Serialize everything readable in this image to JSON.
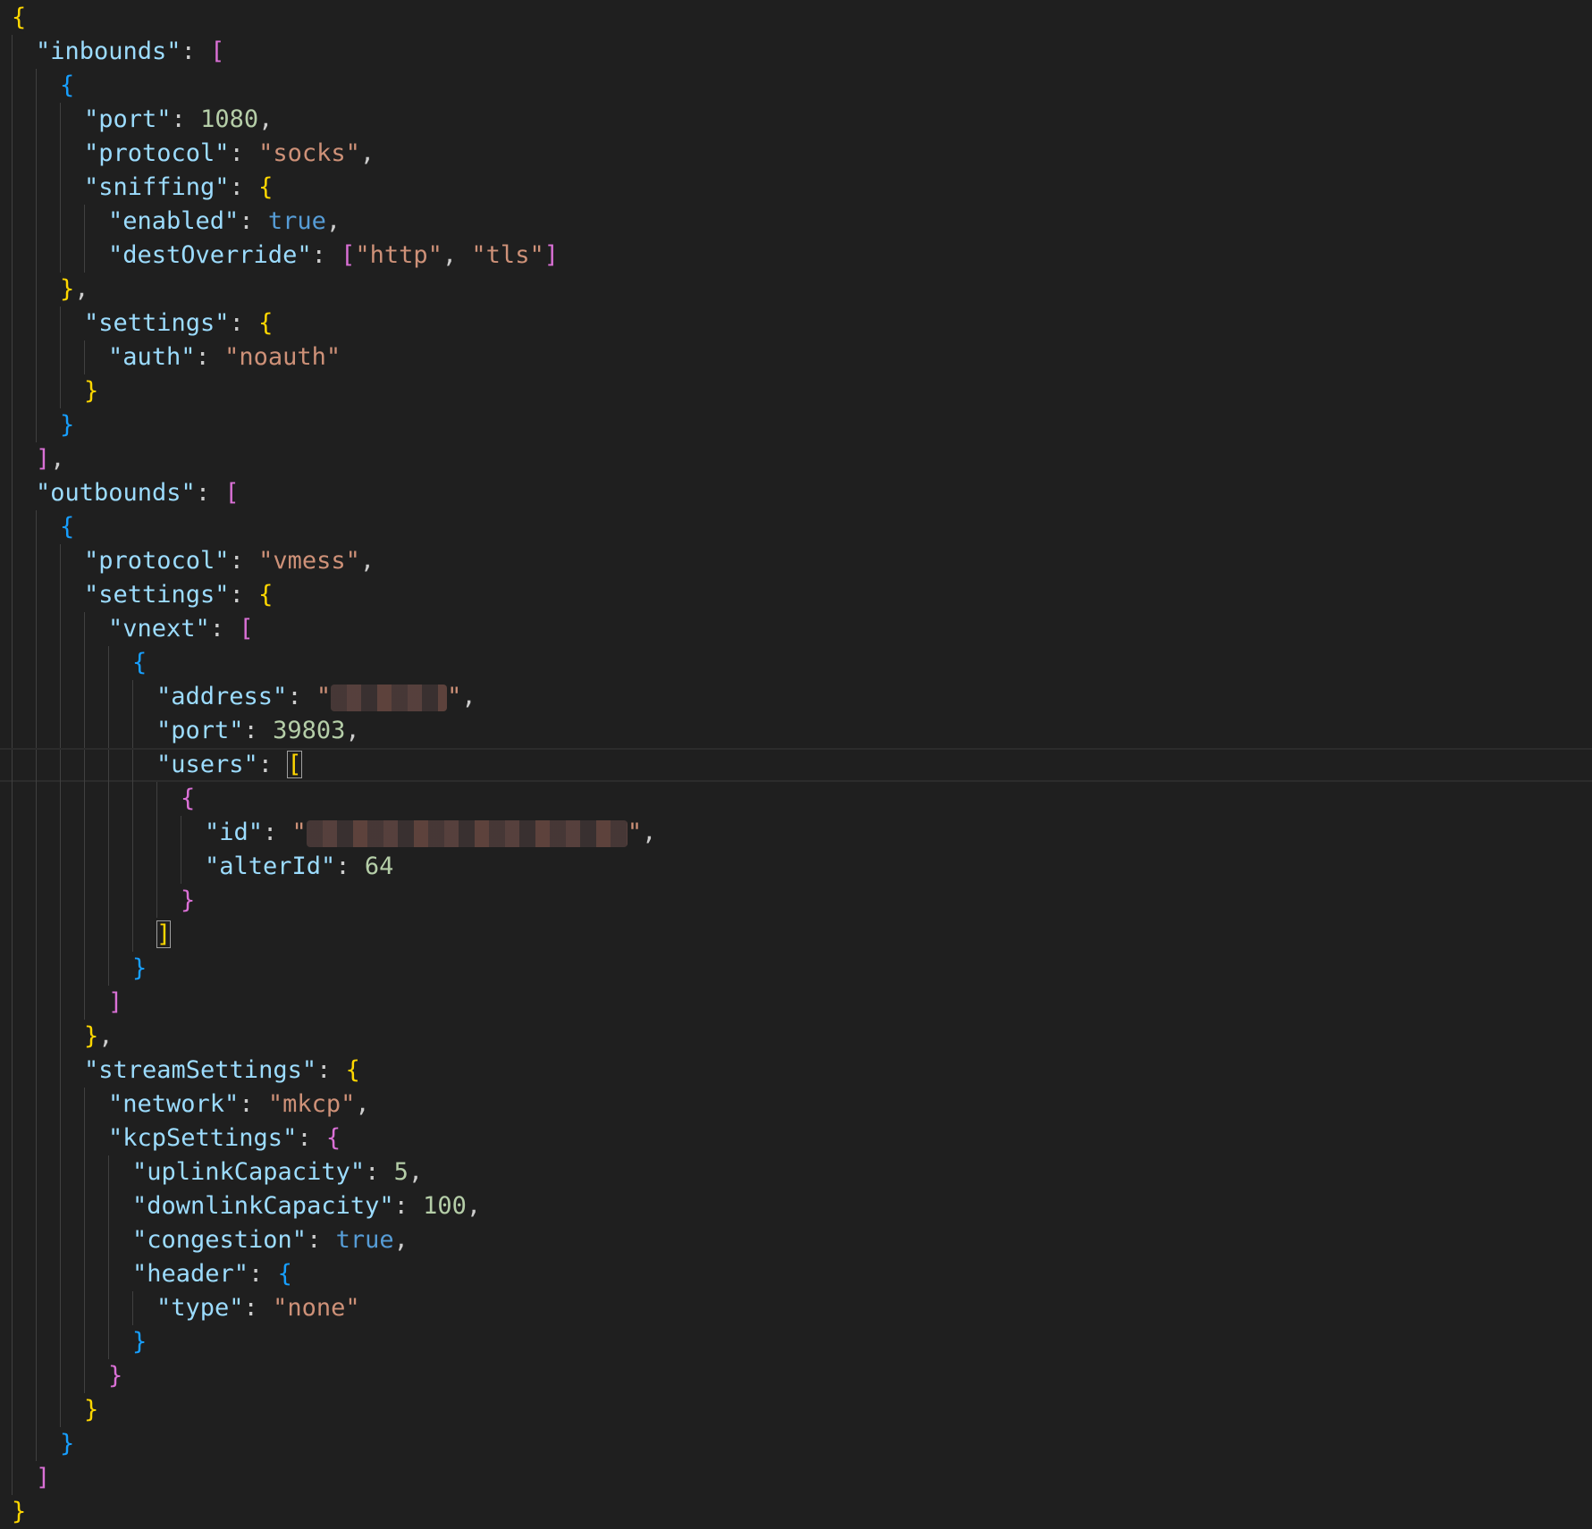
{
  "editor": {
    "lines": [
      {
        "indent": 0,
        "current": false,
        "tokens": [
          {
            "t": "{",
            "c": "y"
          }
        ]
      },
      {
        "indent": 1,
        "current": false,
        "tokens": [
          {
            "t": "\"inbounds\"",
            "c": "k"
          },
          {
            "t": ": ",
            "c": "p"
          },
          {
            "t": "[",
            "c": "m"
          }
        ]
      },
      {
        "indent": 2,
        "current": false,
        "tokens": [
          {
            "t": "{",
            "c": "c"
          }
        ]
      },
      {
        "indent": 3,
        "current": false,
        "tokens": [
          {
            "t": "\"port\"",
            "c": "k"
          },
          {
            "t": ": ",
            "c": "p"
          },
          {
            "t": "1080",
            "c": "n"
          },
          {
            "t": ",",
            "c": "p"
          }
        ]
      },
      {
        "indent": 3,
        "current": false,
        "tokens": [
          {
            "t": "\"protocol\"",
            "c": "k"
          },
          {
            "t": ": ",
            "c": "p"
          },
          {
            "t": "\"socks\"",
            "c": "s"
          },
          {
            "t": ",",
            "c": "p"
          }
        ]
      },
      {
        "indent": 3,
        "current": false,
        "tokens": [
          {
            "t": "\"sniffing\"",
            "c": "k"
          },
          {
            "t": ": ",
            "c": "p"
          },
          {
            "t": "{",
            "c": "y"
          }
        ]
      },
      {
        "indent": 4,
        "current": false,
        "tokens": [
          {
            "t": "\"enabled\"",
            "c": "k"
          },
          {
            "t": ": ",
            "c": "p"
          },
          {
            "t": "true",
            "c": "b"
          },
          {
            "t": ",",
            "c": "p"
          }
        ]
      },
      {
        "indent": 4,
        "current": false,
        "tokens": [
          {
            "t": "\"destOverride\"",
            "c": "k"
          },
          {
            "t": ": ",
            "c": "p"
          },
          {
            "t": "[",
            "c": "m"
          },
          {
            "t": "\"http\"",
            "c": "s"
          },
          {
            "t": ", ",
            "c": "p"
          },
          {
            "t": "\"tls\"",
            "c": "s"
          },
          {
            "t": "]",
            "c": "m"
          }
        ]
      },
      {
        "indent": 2,
        "current": false,
        "tokens": [
          {
            "t": "}",
            "c": "y"
          },
          {
            "t": ",",
            "c": "p"
          }
        ]
      },
      {
        "indent": 3,
        "current": false,
        "tokens": [
          {
            "t": "\"settings\"",
            "c": "k"
          },
          {
            "t": ": ",
            "c": "p"
          },
          {
            "t": "{",
            "c": "y"
          }
        ]
      },
      {
        "indent": 4,
        "current": false,
        "tokens": [
          {
            "t": "\"auth\"",
            "c": "k"
          },
          {
            "t": ": ",
            "c": "p"
          },
          {
            "t": "\"noauth\"",
            "c": "s"
          }
        ]
      },
      {
        "indent": 3,
        "current": false,
        "tokens": [
          {
            "t": "}",
            "c": "y"
          }
        ]
      },
      {
        "indent": 2,
        "current": false,
        "tokens": [
          {
            "t": "}",
            "c": "c"
          }
        ]
      },
      {
        "indent": 1,
        "current": false,
        "tokens": [
          {
            "t": "]",
            "c": "m"
          },
          {
            "t": ",",
            "c": "p"
          }
        ]
      },
      {
        "indent": 1,
        "current": false,
        "tokens": [
          {
            "t": "\"outbounds\"",
            "c": "k"
          },
          {
            "t": ": ",
            "c": "p"
          },
          {
            "t": "[",
            "c": "m"
          }
        ]
      },
      {
        "indent": 2,
        "current": false,
        "tokens": [
          {
            "t": "{",
            "c": "c"
          }
        ]
      },
      {
        "indent": 3,
        "current": false,
        "tokens": [
          {
            "t": "\"protocol\"",
            "c": "k"
          },
          {
            "t": ": ",
            "c": "p"
          },
          {
            "t": "\"vmess\"",
            "c": "s"
          },
          {
            "t": ",",
            "c": "p"
          }
        ]
      },
      {
        "indent": 3,
        "current": false,
        "tokens": [
          {
            "t": "\"settings\"",
            "c": "k"
          },
          {
            "t": ": ",
            "c": "p"
          },
          {
            "t": "{",
            "c": "y"
          }
        ]
      },
      {
        "indent": 4,
        "current": false,
        "tokens": [
          {
            "t": "\"vnext\"",
            "c": "k"
          },
          {
            "t": ": ",
            "c": "p"
          },
          {
            "t": "[",
            "c": "m"
          }
        ]
      },
      {
        "indent": 5,
        "current": false,
        "tokens": [
          {
            "t": "{",
            "c": "c"
          }
        ]
      },
      {
        "indent": 6,
        "current": false,
        "tokens": [
          {
            "t": "\"address\"",
            "c": "k"
          },
          {
            "t": ": ",
            "c": "p"
          },
          {
            "t": "\"",
            "c": "s"
          },
          {
            "redact": 8
          },
          {
            "t": "\"",
            "c": "s"
          },
          {
            "t": ",",
            "c": "p"
          }
        ]
      },
      {
        "indent": 6,
        "current": false,
        "tokens": [
          {
            "t": "\"port\"",
            "c": "k"
          },
          {
            "t": ": ",
            "c": "p"
          },
          {
            "t": "39803",
            "c": "n"
          },
          {
            "t": ",",
            "c": "p"
          }
        ]
      },
      {
        "indent": 6,
        "current": true,
        "tokens": [
          {
            "t": "\"users\"",
            "c": "k"
          },
          {
            "t": ": ",
            "c": "p"
          },
          {
            "t": "[",
            "c": "y",
            "match": true
          }
        ]
      },
      {
        "indent": 7,
        "current": false,
        "tokens": [
          {
            "t": "{",
            "c": "m"
          }
        ]
      },
      {
        "indent": 8,
        "current": false,
        "tokens": [
          {
            "t": "\"id\"",
            "c": "k"
          },
          {
            "t": ": ",
            "c": "p"
          },
          {
            "t": "\"",
            "c": "s"
          },
          {
            "redact": 22
          },
          {
            "t": "\"",
            "c": "s"
          },
          {
            "t": ",",
            "c": "p"
          }
        ]
      },
      {
        "indent": 8,
        "current": false,
        "tokens": [
          {
            "t": "\"alterId\"",
            "c": "k"
          },
          {
            "t": ": ",
            "c": "p"
          },
          {
            "t": "64",
            "c": "n"
          }
        ]
      },
      {
        "indent": 7,
        "current": false,
        "tokens": [
          {
            "t": "}",
            "c": "m"
          }
        ]
      },
      {
        "indent": 6,
        "current": false,
        "tokens": [
          {
            "t": "]",
            "c": "y",
            "match": true
          }
        ]
      },
      {
        "indent": 5,
        "current": false,
        "tokens": [
          {
            "t": "}",
            "c": "c"
          }
        ]
      },
      {
        "indent": 4,
        "current": false,
        "tokens": [
          {
            "t": "]",
            "c": "m"
          }
        ]
      },
      {
        "indent": 3,
        "current": false,
        "tokens": [
          {
            "t": "}",
            "c": "y"
          },
          {
            "t": ",",
            "c": "p"
          }
        ]
      },
      {
        "indent": 3,
        "current": false,
        "tokens": [
          {
            "t": "\"streamSettings\"",
            "c": "k"
          },
          {
            "t": ": ",
            "c": "p"
          },
          {
            "t": "{",
            "c": "y"
          }
        ]
      },
      {
        "indent": 4,
        "current": false,
        "tokens": [
          {
            "t": "\"network\"",
            "c": "k"
          },
          {
            "t": ": ",
            "c": "p"
          },
          {
            "t": "\"mkcp\"",
            "c": "s"
          },
          {
            "t": ",",
            "c": "p"
          }
        ]
      },
      {
        "indent": 4,
        "current": false,
        "tokens": [
          {
            "t": "\"kcpSettings\"",
            "c": "k"
          },
          {
            "t": ": ",
            "c": "p"
          },
          {
            "t": "{",
            "c": "m"
          }
        ]
      },
      {
        "indent": 5,
        "current": false,
        "tokens": [
          {
            "t": "\"uplinkCapacity\"",
            "c": "k"
          },
          {
            "t": ": ",
            "c": "p"
          },
          {
            "t": "5",
            "c": "n"
          },
          {
            "t": ",",
            "c": "p"
          }
        ]
      },
      {
        "indent": 5,
        "current": false,
        "tokens": [
          {
            "t": "\"downlinkCapacity\"",
            "c": "k"
          },
          {
            "t": ": ",
            "c": "p"
          },
          {
            "t": "100",
            "c": "n"
          },
          {
            "t": ",",
            "c": "p"
          }
        ]
      },
      {
        "indent": 5,
        "current": false,
        "tokens": [
          {
            "t": "\"congestion\"",
            "c": "k"
          },
          {
            "t": ": ",
            "c": "p"
          },
          {
            "t": "true",
            "c": "b"
          },
          {
            "t": ",",
            "c": "p"
          }
        ]
      },
      {
        "indent": 5,
        "current": false,
        "tokens": [
          {
            "t": "\"header\"",
            "c": "k"
          },
          {
            "t": ": ",
            "c": "p"
          },
          {
            "t": "{",
            "c": "c"
          }
        ]
      },
      {
        "indent": 6,
        "current": false,
        "tokens": [
          {
            "t": "\"type\"",
            "c": "k"
          },
          {
            "t": ": ",
            "c": "p"
          },
          {
            "t": "\"none\"",
            "c": "s"
          }
        ]
      },
      {
        "indent": 5,
        "current": false,
        "tokens": [
          {
            "t": "}",
            "c": "c"
          }
        ]
      },
      {
        "indent": 4,
        "current": false,
        "tokens": [
          {
            "t": "}",
            "c": "m"
          }
        ]
      },
      {
        "indent": 3,
        "current": false,
        "tokens": [
          {
            "t": "}",
            "c": "y"
          }
        ]
      },
      {
        "indent": 2,
        "current": false,
        "tokens": [
          {
            "t": "}",
            "c": "c"
          }
        ]
      },
      {
        "indent": 1,
        "current": false,
        "tokens": [
          {
            "t": "]",
            "c": "m"
          }
        ]
      },
      {
        "indent": 0,
        "current": false,
        "tokens": [
          {
            "t": "}",
            "c": "y"
          }
        ]
      }
    ]
  },
  "colors": {
    "background": "#1f1f1f",
    "key": "#9cdcfe",
    "string": "#ce9178",
    "number": "#b5cea8",
    "boolean": "#569cd6",
    "bracket_level_1": "#ffd700",
    "bracket_level_2": "#da70d6",
    "bracket_level_3": "#179fff"
  }
}
